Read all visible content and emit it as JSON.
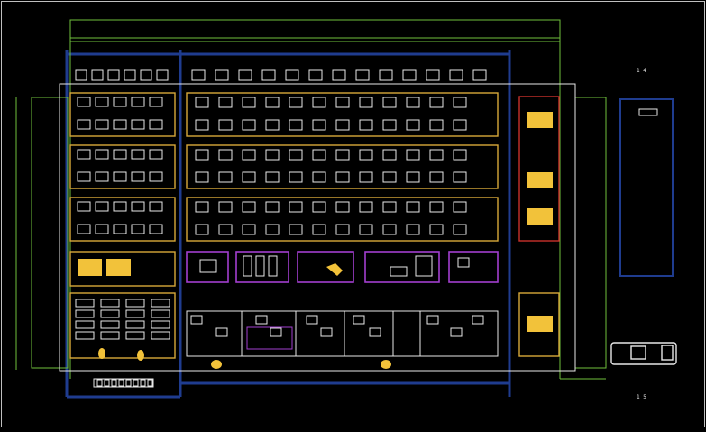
{
  "drawing": {
    "labels": {
      "north_marker": "1 4",
      "south_marker": "1 5"
    },
    "colors": {
      "background": "#000000",
      "frame": "#bfbfbf",
      "wall_white": "#e8e8e8",
      "dimension_green": "#6fbf3c",
      "room_yellow": "#d8a83a",
      "room_purple": "#a23fcf",
      "room_red": "#c8302c",
      "grid_blue": "#1f3c8f",
      "fill_yellow": "#f2c23a"
    }
  }
}
